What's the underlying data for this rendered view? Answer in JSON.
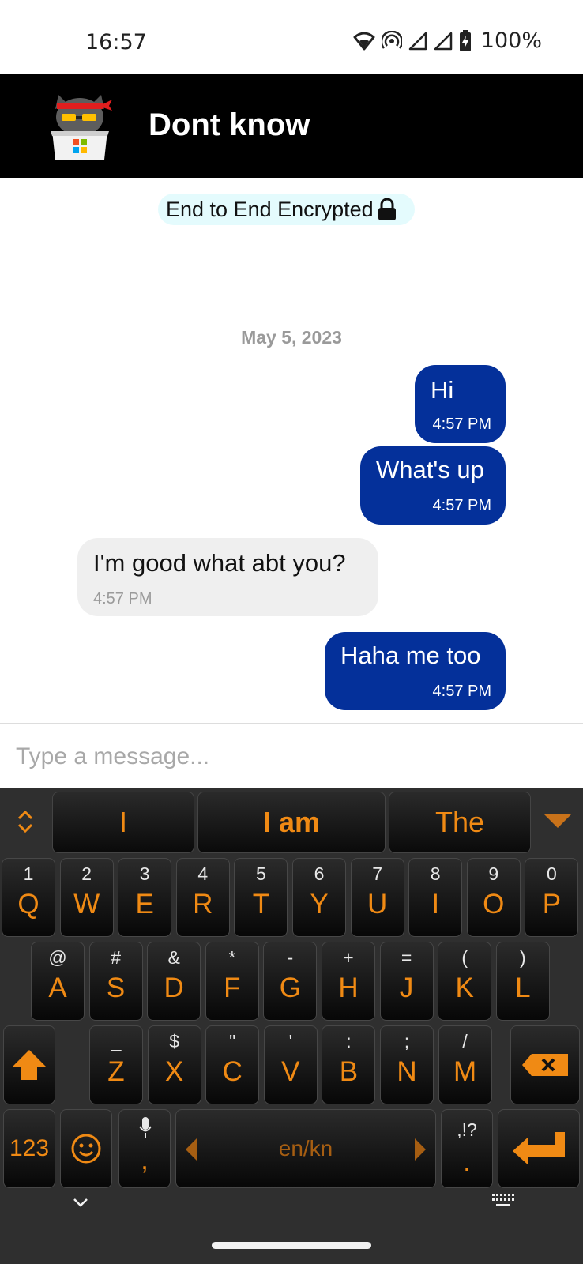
{
  "status_bar": {
    "time": "16:57",
    "battery": "100%"
  },
  "header": {
    "title": "Dont know",
    "avatar_icon": "ninja-cat-icon"
  },
  "encryption_notice": "End to End Encrypted",
  "date_separator": "May 5, 2023",
  "messages": [
    {
      "direction": "outgoing",
      "text": "Hi",
      "time": "4:57 PM"
    },
    {
      "direction": "outgoing",
      "text": "What's up",
      "time": "4:57 PM"
    },
    {
      "direction": "incoming",
      "text": "I'm good what abt you?",
      "time": "4:57 PM"
    },
    {
      "direction": "outgoing",
      "text": "Haha me too",
      "time": "4:57 PM"
    }
  ],
  "composer": {
    "placeholder": "Type a message..."
  },
  "keyboard": {
    "suggestions": [
      "I",
      "I am",
      "The"
    ],
    "row1": [
      {
        "sec": "1",
        "pri": "Q"
      },
      {
        "sec": "2",
        "pri": "W"
      },
      {
        "sec": "3",
        "pri": "E"
      },
      {
        "sec": "4",
        "pri": "R"
      },
      {
        "sec": "5",
        "pri": "T"
      },
      {
        "sec": "6",
        "pri": "Y"
      },
      {
        "sec": "7",
        "pri": "U"
      },
      {
        "sec": "8",
        "pri": "I"
      },
      {
        "sec": "9",
        "pri": "O"
      },
      {
        "sec": "0",
        "pri": "P"
      }
    ],
    "row2": [
      {
        "sec": "@",
        "pri": "A"
      },
      {
        "sec": "#",
        "pri": "S"
      },
      {
        "sec": "&",
        "pri": "D"
      },
      {
        "sec": "*",
        "pri": "F"
      },
      {
        "sec": "-",
        "pri": "G"
      },
      {
        "sec": "+",
        "pri": "H"
      },
      {
        "sec": "=",
        "pri": "J"
      },
      {
        "sec": "(",
        "pri": "K"
      },
      {
        "sec": ")",
        "pri": "L"
      }
    ],
    "row3": [
      {
        "sec": "_",
        "pri": "Z"
      },
      {
        "sec": "$",
        "pri": "X"
      },
      {
        "sec": "\"",
        "pri": "C"
      },
      {
        "sec": "'",
        "pri": "V"
      },
      {
        "sec": ":",
        "pri": "B"
      },
      {
        "sec": ";",
        "pri": "N"
      },
      {
        "sec": "/",
        "pri": "M"
      }
    ],
    "numbers_label": "123",
    "comma_label": ",",
    "space_label": "en/kn",
    "punct_sec": ",!?",
    "punct_pri": ".",
    "accent_color": "#f08a14"
  },
  "colors": {
    "outgoing_bubble": "#04309a",
    "incoming_bubble": "#efefef",
    "header_bg": "#000000",
    "encrypt_pill": "#e4fbfd"
  }
}
